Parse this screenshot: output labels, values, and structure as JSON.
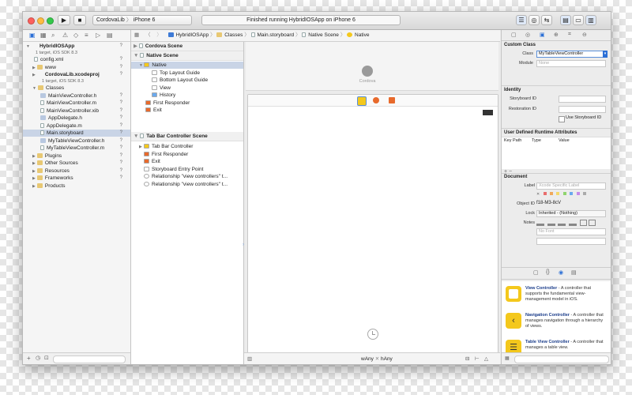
{
  "toolbar": {
    "scheme_project": "CordovaLib",
    "scheme_device": "iPhone 6",
    "status": "Finished running HybridIOSApp on iPhone 6"
  },
  "navigator": {
    "items": [
      {
        "label": "HybridIOSApp",
        "sub": "1 target, iOS SDK 8.3",
        "kind": "project",
        "indent": 0,
        "badge": "?"
      },
      {
        "label": "config.xml",
        "kind": "file",
        "indent": 1,
        "badge": "?"
      },
      {
        "label": "www",
        "kind": "folder",
        "indent": 1,
        "badge": "?"
      },
      {
        "label": "CordovaLib.xcodeproj",
        "sub": "1 target, iOS SDK 8.3",
        "kind": "project",
        "indent": 1,
        "badge": "?"
      },
      {
        "label": "Classes",
        "kind": "folder",
        "indent": 1,
        "badge": ""
      },
      {
        "label": "MainViewController.h",
        "kind": "fileh",
        "indent": 2,
        "badge": "?"
      },
      {
        "label": "MainViewController.m",
        "kind": "file",
        "indent": 2,
        "badge": "?"
      },
      {
        "label": "MainViewController.xib",
        "kind": "file",
        "indent": 2,
        "badge": "?"
      },
      {
        "label": "AppDelegate.h",
        "kind": "fileh",
        "indent": 2,
        "badge": "?"
      },
      {
        "label": "AppDelegate.m",
        "kind": "file",
        "indent": 2,
        "badge": "?"
      },
      {
        "label": "Main.storyboard",
        "kind": "file",
        "indent": 2,
        "badge": "?",
        "selected": true
      },
      {
        "label": "MyTableViewController.h",
        "kind": "fileh",
        "indent": 2,
        "badge": "?"
      },
      {
        "label": "MyTableViewController.m",
        "kind": "file",
        "indent": 2,
        "badge": "?"
      },
      {
        "label": "Plugins",
        "kind": "folder",
        "indent": 1,
        "badge": "?"
      },
      {
        "label": "Other Sources",
        "kind": "folder",
        "indent": 1,
        "badge": "?"
      },
      {
        "label": "Resources",
        "kind": "folder",
        "indent": 1,
        "badge": "?"
      },
      {
        "label": "Frameworks",
        "kind": "folder",
        "indent": 1,
        "badge": "?"
      },
      {
        "label": "Products",
        "kind": "folder",
        "indent": 1,
        "badge": ""
      }
    ]
  },
  "jumpbar": {
    "crumbs": [
      "HybridIOSApp",
      "Classes",
      "Main.storyboard",
      "Native Scene",
      "Native"
    ]
  },
  "outline": {
    "scene1": "Cordova Scene",
    "scene2": "Native Scene",
    "native_items": [
      "Native",
      "Top Layout Guide",
      "Bottom Layout Guide",
      "View",
      "History",
      "First Responder",
      "Exit"
    ],
    "scene3": "Tab Bar Controller Scene",
    "tab_items": [
      "Tab Bar Controller",
      "First Responder",
      "Exit",
      "Storyboard Entry Point",
      "Relationship \"view controllers\" t...",
      "Relationship \"view controllers\" t..."
    ]
  },
  "canvas": {
    "cordova_label": "Cordova",
    "size_w": "wAny",
    "size_h": "hAny"
  },
  "inspector": {
    "custom_class": {
      "title": "Custom Class",
      "class_label": "Class",
      "class_value": "MyTableViewController",
      "module_label": "Module",
      "module_value": "None"
    },
    "identity": {
      "title": "Identity",
      "storyboard_id": "Storyboard ID",
      "restoration_id": "Restoration ID",
      "use_storyboard_id": "Use Storyboard ID"
    },
    "runtime": {
      "title": "User Defined Runtime Attributes",
      "cols": [
        "Key Path",
        "Type",
        "Value"
      ]
    },
    "document": {
      "title": "Document",
      "label_label": "Label",
      "label_placeholder": "Xcode Specific Label",
      "object_id_label": "Object ID",
      "object_id_value": "f18-M3-8cV",
      "lock_label": "Lock",
      "lock_value": "Inherited - (Nothing)",
      "notes_label": "Notes",
      "font_placeholder": "No Font"
    },
    "library": [
      {
        "title": "View Controller",
        "desc": " - A controller that supports the fundamental view-management model in iOS.",
        "color": "#f4c81c"
      },
      {
        "title": "Navigation Controller",
        "desc": " - A controller that manages navigation through a hierarchy of views.",
        "color": "#f4c81c"
      },
      {
        "title": "Table View Controller",
        "desc": " - A controller that manages a table view.",
        "color": "#f4c81c"
      }
    ]
  }
}
